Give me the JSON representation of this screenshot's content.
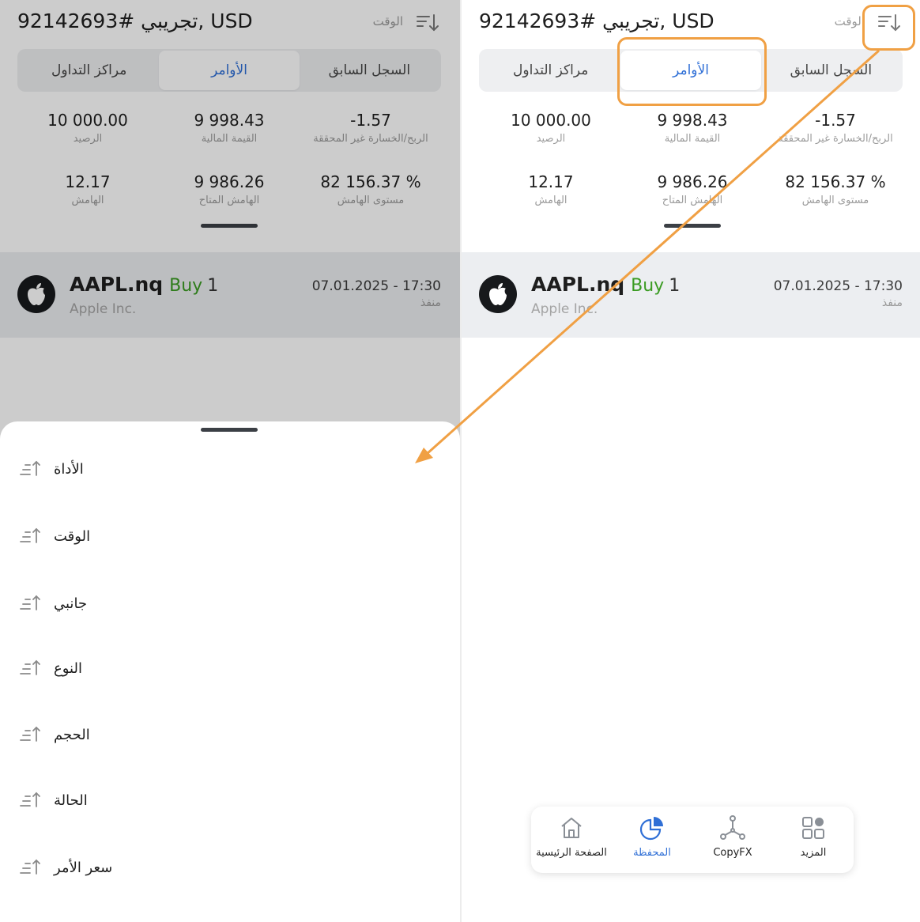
{
  "header": {
    "account_title": "تجريبي #92142693, USD",
    "sort_label": "الوقت"
  },
  "tabs": [
    {
      "label": "السجل السابق"
    },
    {
      "label": "الأوامر",
      "active": true
    },
    {
      "label": "مراكز التداول"
    }
  ],
  "stats": [
    {
      "value": "-1.57",
      "label": "الربح/الخسارة غير المحققة"
    },
    {
      "value": "9 998.43",
      "label": "القيمة المالية"
    },
    {
      "value": "10 000.00",
      "label": "الرصيد"
    },
    {
      "value": "82 156.37 %",
      "label": "مستوى الهامش"
    },
    {
      "value": "9 986.26",
      "label": "الهامش المتاح"
    },
    {
      "value": "12.17",
      "label": "الهامش"
    }
  ],
  "order": {
    "symbol": "AAPL.nq",
    "side": "Buy",
    "volume": "1",
    "company": "Apple Inc.",
    "time": "07.01.2025 - 17:30",
    "status": "منفذ",
    "icon": "apple-icon"
  },
  "sort_options": [
    {
      "label": "الأداة"
    },
    {
      "label": "الوقت"
    },
    {
      "label": "جانبي"
    },
    {
      "label": "النوع"
    },
    {
      "label": "الحجم"
    },
    {
      "label": "الحالة"
    },
    {
      "label": "سعر الأمر"
    }
  ],
  "bottom_nav": [
    {
      "label": "الصفحة الرئيسية",
      "icon": "home-icon"
    },
    {
      "label": "المحفظة",
      "icon": "portfolio-icon",
      "active": true
    },
    {
      "label": "CopyFX",
      "icon": "copyfx-icon"
    },
    {
      "label": "المزيد",
      "icon": "more-icon"
    }
  ],
  "colors": {
    "accent": "#2f6fd6",
    "buy": "#3a9b22",
    "annotation": "#f0a044",
    "row_bg": "#eceef1"
  }
}
